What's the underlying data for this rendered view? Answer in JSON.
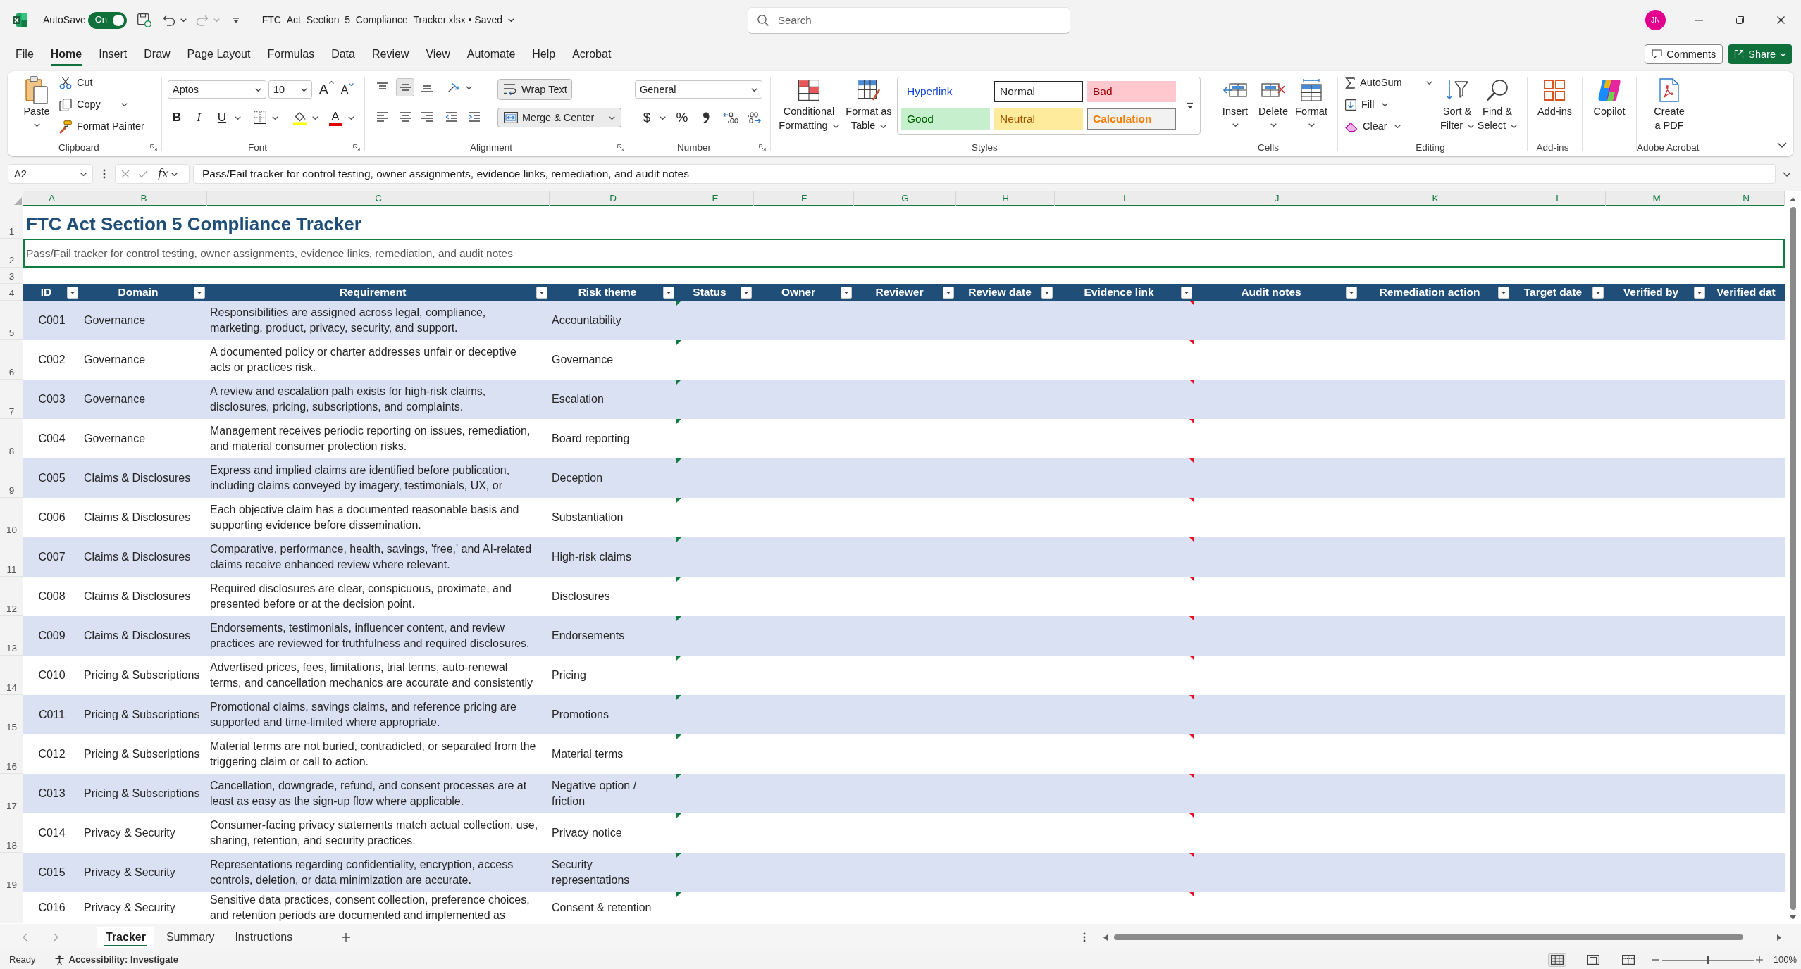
{
  "title_bar": {
    "autosave_label": "AutoSave",
    "autosave": {
      "on": true,
      "label": "On"
    },
    "undo": {
      "disabled": false
    },
    "redo": {
      "disabled": true
    },
    "document_title": "FTC_Act_Section_5_Compliance_Tracker.xlsx • Saved",
    "search": {
      "placeholder": "Search"
    },
    "account_initials": "JN"
  },
  "ribbon_tabs": [
    {
      "label": "File",
      "selected": false
    },
    {
      "label": "Home",
      "selected": true
    },
    {
      "label": "Insert",
      "selected": false
    },
    {
      "label": "Draw",
      "selected": false
    },
    {
      "label": "Page Layout",
      "selected": false
    },
    {
      "label": "Formulas",
      "selected": false
    },
    {
      "label": "Data",
      "selected": false
    },
    {
      "label": "Review",
      "selected": false
    },
    {
      "label": "View",
      "selected": false
    },
    {
      "label": "Automate",
      "selected": false
    },
    {
      "label": "Help",
      "selected": false
    },
    {
      "label": "Acrobat",
      "selected": false
    }
  ],
  "ribbon_actions": {
    "comments": "Comments",
    "share": "Share"
  },
  "ribbon_groups": [
    {
      "kind": "clipboard",
      "label": "Clipboard",
      "launcher": true,
      "paste": "Paste",
      "cut": "Cut",
      "copy": "Copy",
      "format_painter": "Format Painter"
    },
    {
      "kind": "font",
      "label": "Font",
      "launcher": true,
      "font_name": "Aptos",
      "font_size": "10",
      "grow_glyph": "A",
      "shrink_glyph": "A",
      "styles": [
        {
          "kind": "bold",
          "glyph": "B"
        },
        {
          "kind": "italic",
          "glyph": "I"
        },
        {
          "kind": "underline",
          "glyph": "U"
        }
      ],
      "font_color_glyph": "A"
    },
    {
      "kind": "alignment",
      "label": "Alignment",
      "launcher": true,
      "vertical": [
        {
          "kind": "top",
          "selected": false
        },
        {
          "kind": "middle",
          "selected": true
        },
        {
          "kind": "bottom",
          "selected": false
        }
      ],
      "horizontal": [
        {
          "kind": "left",
          "selected": false
        },
        {
          "kind": "center",
          "selected": false
        },
        {
          "kind": "right",
          "selected": false
        }
      ],
      "wrap_text": {
        "label": "Wrap Text",
        "on": true
      },
      "merge_center": {
        "label": "Merge & Center",
        "on": true
      }
    },
    {
      "kind": "number",
      "label": "Number",
      "launcher": true,
      "format": "General",
      "currency_glyph": "$",
      "percent_glyph": "%"
    },
    {
      "kind": "styles",
      "label": "Styles",
      "conditional_formatting": "Conditional Formatting",
      "format_as_table": "Format as Table",
      "gallery": [
        {
          "kind": "hyperlink",
          "label": "Hyperlink",
          "selected": false
        },
        {
          "kind": "normal",
          "label": "Normal",
          "selected": true
        },
        {
          "kind": "bad",
          "label": "Bad",
          "selected": false
        },
        {
          "kind": "good",
          "label": "Good",
          "selected": false
        },
        {
          "kind": "neutral",
          "label": "Neutral",
          "selected": false
        },
        {
          "kind": "calculation",
          "label": "Calculation",
          "selected": false
        }
      ]
    },
    {
      "kind": "cells",
      "label": "Cells",
      "commands": [
        {
          "kind": "insert",
          "label": "Insert"
        },
        {
          "kind": "delete",
          "label": "Delete"
        },
        {
          "kind": "format",
          "label": "Format"
        }
      ]
    },
    {
      "kind": "editing",
      "label": "Editing",
      "autosum": "AutoSum",
      "fill": "Fill",
      "clear": "Clear",
      "sort_filter": "Sort & Filter",
      "find_select": "Find & Select"
    },
    {
      "kind": "addins",
      "label": "Add-ins",
      "command": "Add-ins"
    },
    {
      "kind": "copilot",
      "command": "Copilot"
    },
    {
      "kind": "acrobat",
      "label": "Adobe Acrobat",
      "command": "Create a PDF"
    }
  ],
  "formula_bar": {
    "name_box": "A2",
    "function_glyph": "fx",
    "content": "Pass/Fail tracker for control testing, owner assignments, evidence links, remediation, and audit notes"
  },
  "sheet": {
    "columns": [
      {
        "letter": "A",
        "selected": true
      },
      {
        "letter": "B",
        "selected": true
      },
      {
        "letter": "C",
        "selected": true
      },
      {
        "letter": "D",
        "selected": true
      },
      {
        "letter": "E",
        "selected": true
      },
      {
        "letter": "F",
        "selected": true
      },
      {
        "letter": "G",
        "selected": true
      },
      {
        "letter": "H",
        "selected": true
      },
      {
        "letter": "I",
        "selected": true
      },
      {
        "letter": "J",
        "selected": true
      },
      {
        "letter": "K",
        "selected": true
      },
      {
        "letter": "L",
        "selected": true
      },
      {
        "letter": "M",
        "selected": true
      },
      {
        "letter": "N",
        "selected": true
      }
    ],
    "title": {
      "row_number": "1",
      "text": "FTC Act Section 5 Compliance Tracker",
      "selected": false
    },
    "subtitle": {
      "row_number": "2",
      "text": "Pass/Fail tracker for control testing, owner assignments, evidence links, remediation, and audit notes",
      "selected": true
    },
    "blank_row": {
      "row_number": "3"
    },
    "header": {
      "row_number": "4",
      "columns": [
        {
          "label": "ID",
          "filter": true
        },
        {
          "label": "Domain",
          "filter": true
        },
        {
          "label": "Requirement",
          "filter": true
        },
        {
          "label": "Risk theme",
          "filter": true
        },
        {
          "label": "Status",
          "filter": true
        },
        {
          "label": "Owner",
          "filter": true
        },
        {
          "label": "Reviewer",
          "filter": true
        },
        {
          "label": "Review date",
          "filter": true
        },
        {
          "label": "Evidence link",
          "filter": true
        },
        {
          "label": "Audit notes",
          "filter": true
        },
        {
          "label": "Remediation action",
          "filter": true
        },
        {
          "label": "Target date",
          "filter": true
        },
        {
          "label": "Verified by",
          "filter": true
        },
        {
          "label": "Verified dat"
        }
      ]
    },
    "rows": [
      {
        "row_number": "5",
        "id": "C001",
        "domain": "Governance",
        "requirement": "Responsibilities are assigned across legal, compliance, marketing, product, privacy, security, and support.",
        "risk_theme": "Accountability",
        "error_indicator": true,
        "comment_indicator": true
      },
      {
        "row_number": "6",
        "id": "C002",
        "domain": "Governance",
        "requirement": "A documented policy or charter addresses unfair or deceptive acts or practices risk.",
        "risk_theme": "Governance",
        "error_indicator": true,
        "comment_indicator": true
      },
      {
        "row_number": "7",
        "id": "C003",
        "domain": "Governance",
        "requirement": "A review and escalation path exists for high-risk claims, disclosures, pricing, subscriptions, and complaints.",
        "risk_theme": "Escalation",
        "error_indicator": true,
        "comment_indicator": true
      },
      {
        "row_number": "8",
        "id": "C004",
        "domain": "Governance",
        "requirement": "Management receives periodic reporting on issues, remediation, and material consumer protection risks.",
        "risk_theme": "Board reporting",
        "error_indicator": true,
        "comment_indicator": true
      },
      {
        "row_number": "9",
        "id": "C005",
        "domain": "Claims & Disclosures",
        "requirement": "Express and implied claims are identified before publication, including claims conveyed by imagery, testimonials, UX, or",
        "risk_theme": "Deception",
        "error_indicator": true,
        "comment_indicator": true
      },
      {
        "row_number": "10",
        "id": "C006",
        "domain": "Claims & Disclosures",
        "requirement": "Each objective claim has a documented reasonable basis and supporting evidence before dissemination.",
        "risk_theme": "Substantiation",
        "error_indicator": true,
        "comment_indicator": true
      },
      {
        "row_number": "11",
        "id": "C007",
        "domain": "Claims & Disclosures",
        "requirement": "Comparative, performance, health, savings, 'free,' and AI-related claims receive enhanced review where relevant.",
        "risk_theme": "High-risk claims",
        "error_indicator": true,
        "comment_indicator": true
      },
      {
        "row_number": "12",
        "id": "C008",
        "domain": "Claims & Disclosures",
        "requirement": "Required disclosures are clear, conspicuous, proximate, and presented before or at the decision point.",
        "risk_theme": "Disclosures",
        "error_indicator": true,
        "comment_indicator": true
      },
      {
        "row_number": "13",
        "id": "C009",
        "domain": "Claims & Disclosures",
        "requirement": "Endorsements, testimonials, influencer content, and review practices are reviewed for truthfulness and required disclosures.",
        "risk_theme": "Endorsements",
        "error_indicator": true,
        "comment_indicator": true
      },
      {
        "row_number": "14",
        "id": "C010",
        "domain": "Pricing & Subscriptions",
        "requirement": "Advertised prices, fees, limitations, trial terms, auto-renewal terms, and cancellation mechanics are accurate and consistently",
        "risk_theme": "Pricing",
        "error_indicator": true,
        "comment_indicator": true
      },
      {
        "row_number": "15",
        "id": "C011",
        "domain": "Pricing & Subscriptions",
        "requirement": "Promotional claims, savings claims, and reference pricing are supported and time-limited where appropriate.",
        "risk_theme": "Promotions",
        "error_indicator": true,
        "comment_indicator": true
      },
      {
        "row_number": "16",
        "id": "C012",
        "domain": "Pricing & Subscriptions",
        "requirement": "Material terms are not buried, contradicted, or separated from the triggering claim or call to action.",
        "risk_theme": "Material terms",
        "error_indicator": true,
        "comment_indicator": true
      },
      {
        "row_number": "17",
        "id": "C013",
        "domain": "Pricing & Subscriptions",
        "requirement": "Cancellation, downgrade, refund, and consent processes are at least as easy as the sign-up flow where applicable.",
        "risk_theme": "Negative option / friction",
        "error_indicator": true,
        "comment_indicator": true
      },
      {
        "row_number": "18",
        "id": "C014",
        "domain": "Privacy & Security",
        "requirement": "Consumer-facing privacy statements match actual collection, use, sharing, retention, and security practices.",
        "risk_theme": "Privacy notice",
        "error_indicator": true,
        "comment_indicator": true
      },
      {
        "row_number": "19",
        "id": "C015",
        "domain": "Privacy & Security",
        "requirement": "Representations regarding confidentiality, encryption, access controls, deletion, or data minimization are accurate.",
        "risk_theme": "Security representations",
        "error_indicator": true,
        "comment_indicator": true
      },
      {
        "id": "C016",
        "domain": "Privacy & Security",
        "requirement": "Sensitive data practices, consent collection, preference choices, and retention periods are documented and implemented as",
        "risk_theme": "Consent & retention",
        "error_indicator": true,
        "comment_indicator": true
      }
    ]
  },
  "sheet_tabs": [
    {
      "label": "Tracker",
      "selected": true
    },
    {
      "label": "Summary",
      "selected": false
    },
    {
      "label": "Instructions",
      "selected": false
    }
  ],
  "status_bar": {
    "mode": "Ready",
    "accessibility": "Accessibility: Investigate",
    "views": [
      {
        "kind": "normal",
        "selected": true
      },
      {
        "kind": "page_layout",
        "selected": false
      },
      {
        "kind": "page_break",
        "selected": false
      }
    ],
    "zoom": {
      "level": 0.5,
      "reading": "100%"
    }
  }
}
